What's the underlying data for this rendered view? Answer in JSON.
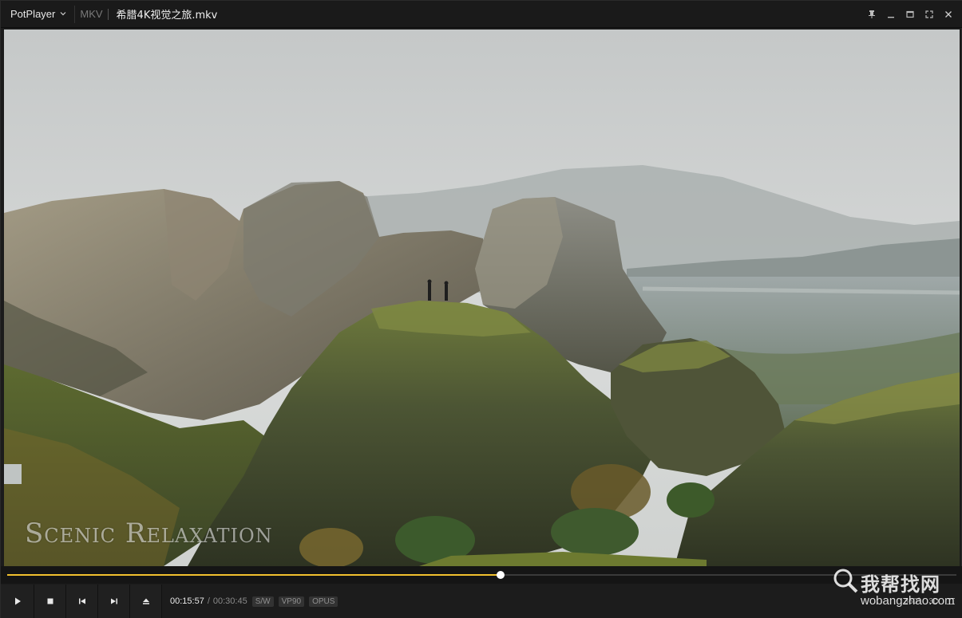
{
  "titlebar": {
    "app_name": "PotPlayer",
    "format": "MKV",
    "filename": "希腊4K视觉之旅.mkv",
    "icons": [
      "pin-icon",
      "minimize-icon",
      "restore-icon",
      "fullscreen-icon",
      "close-icon"
    ]
  },
  "video": {
    "overlay_text": "Scenic Relaxation"
  },
  "playback": {
    "progress": 0.52,
    "current_time": "00:15:57",
    "total_time": "00:30:45",
    "time_separator": "/",
    "badges": [
      "S/W",
      "VP90",
      "OPUS"
    ]
  },
  "controls": {
    "icons": [
      "play-icon",
      "stop-icon",
      "previous-icon",
      "next-icon",
      "eject-icon"
    ],
    "right": [
      "360°",
      "3D"
    ]
  },
  "watermark": {
    "cn": "我帮找网",
    "en": "wobangzhao.com"
  },
  "colors": {
    "accent": "#f2c12e",
    "bg": "#1b1b1b"
  }
}
